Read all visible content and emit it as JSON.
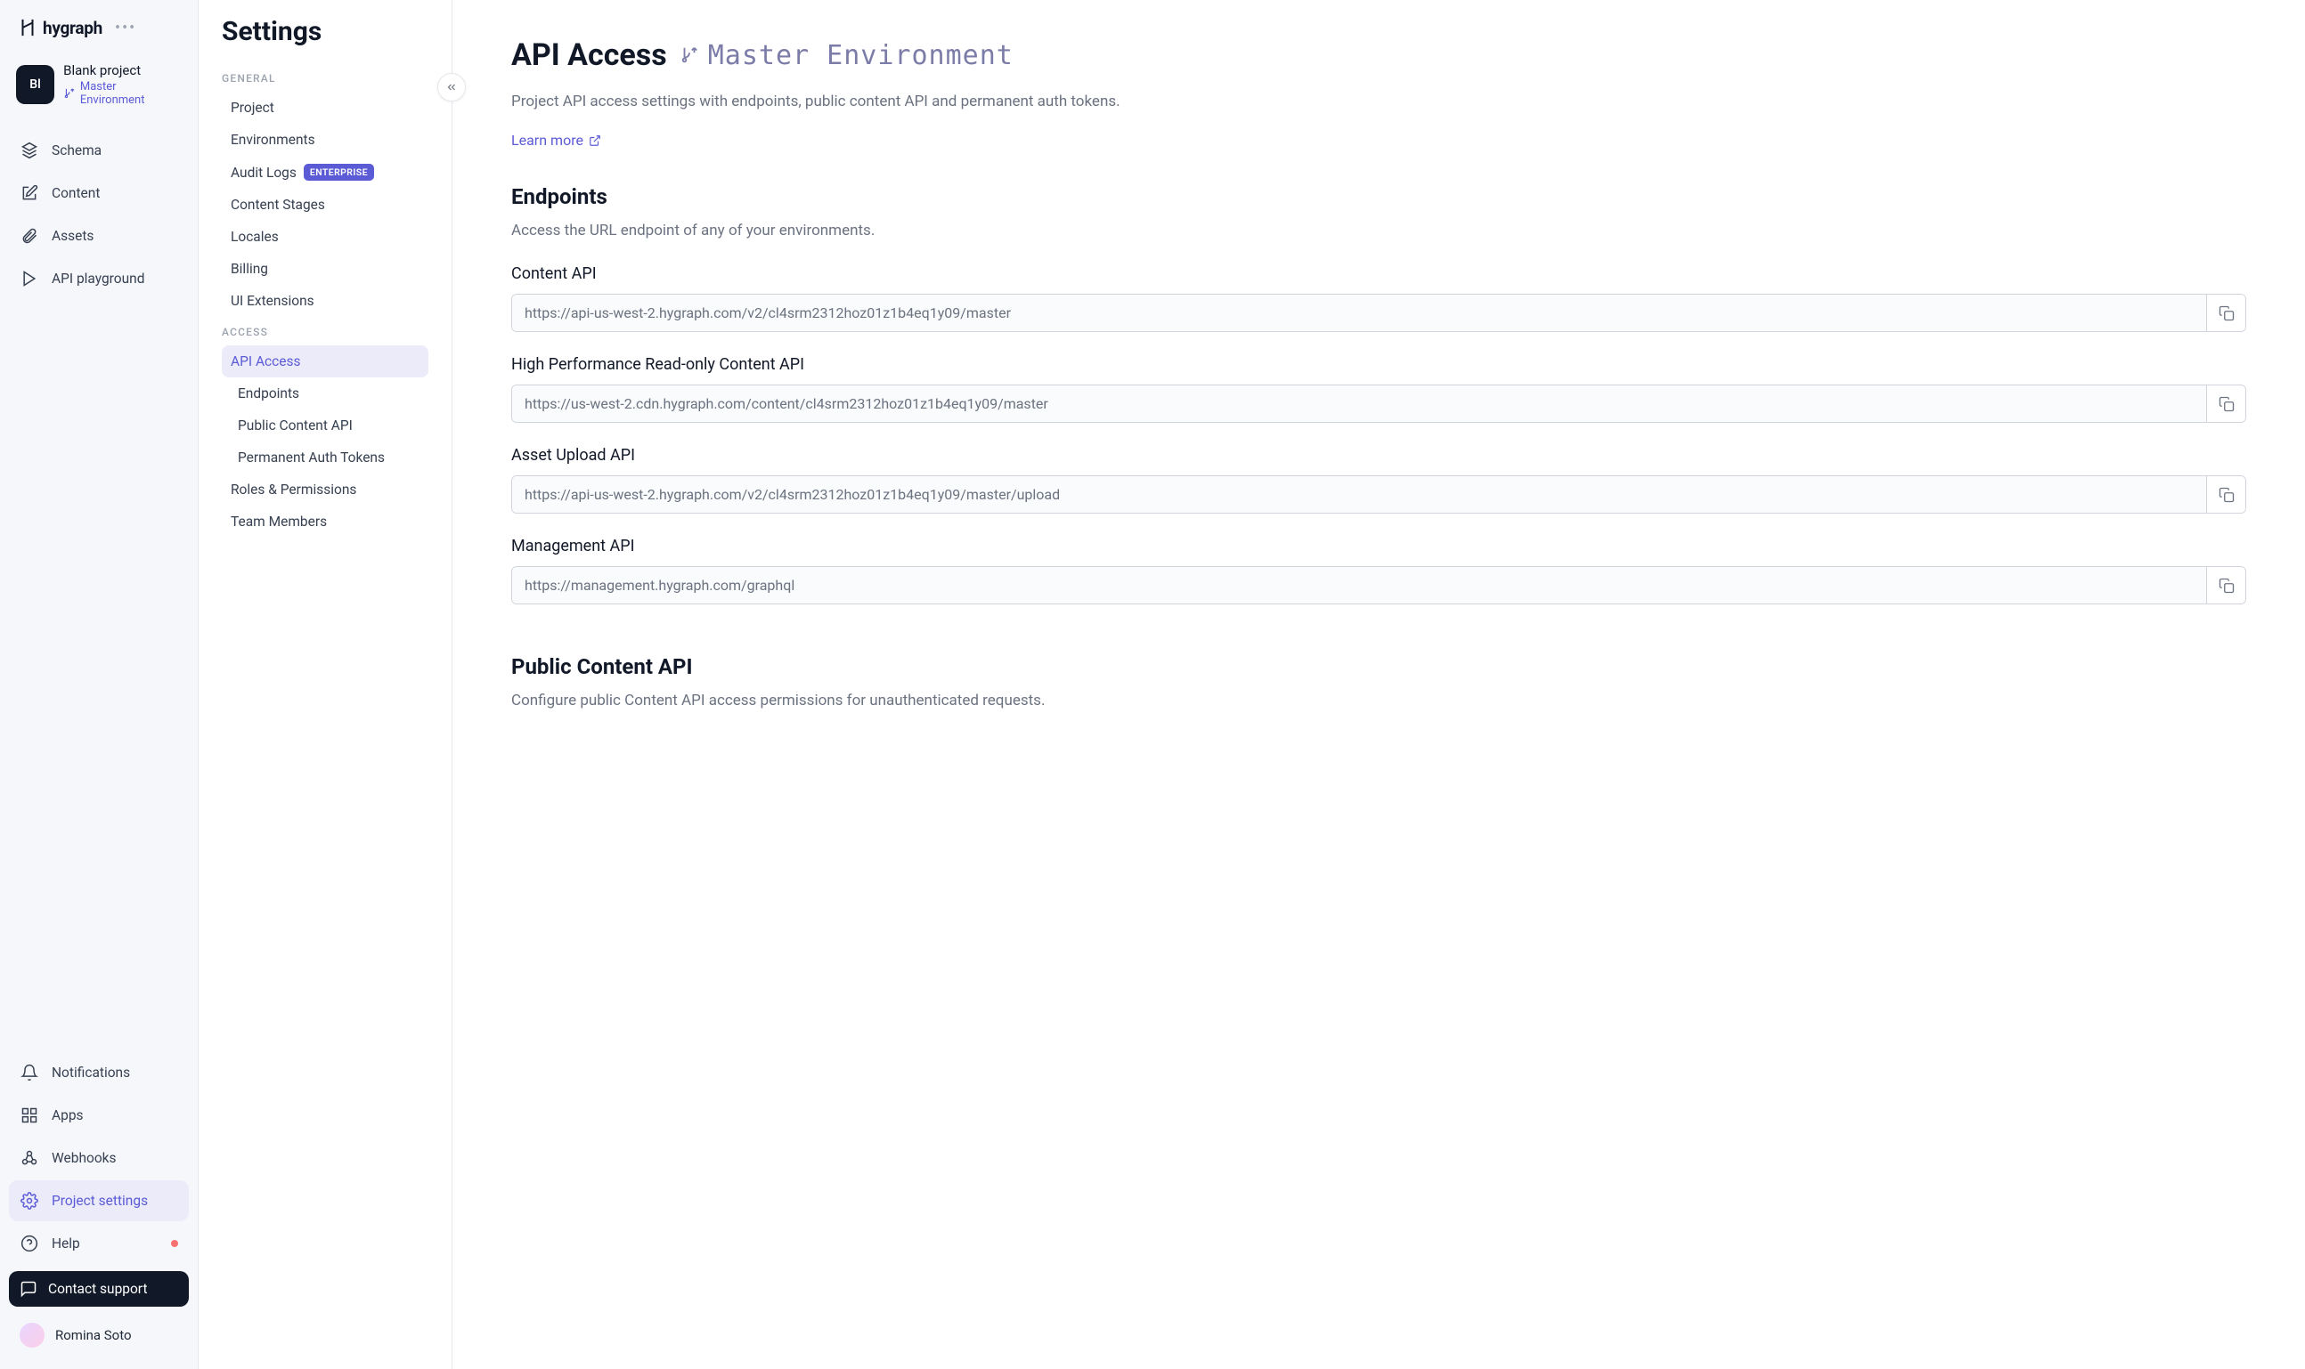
{
  "logo_text": "hygraph",
  "project": {
    "avatar_text": "Bl",
    "name": "Blank project",
    "environment": "Master Environment"
  },
  "nav": {
    "schema": "Schema",
    "content": "Content",
    "assets": "Assets",
    "api_playground": "API playground",
    "notifications": "Notifications",
    "apps": "Apps",
    "webhooks": "Webhooks",
    "project_settings": "Project settings",
    "help": "Help",
    "contact_support": "Contact support"
  },
  "user": {
    "name": "Romina Soto"
  },
  "settings": {
    "title": "Settings",
    "sections": {
      "general_label": "GENERAL",
      "access_label": "ACCESS",
      "project": "Project",
      "environments": "Environments",
      "audit_logs": "Audit Logs",
      "enterprise_badge": "ENTERPRISE",
      "content_stages": "Content Stages",
      "locales": "Locales",
      "billing": "Billing",
      "ui_extensions": "UI Extensions",
      "api_access": "API Access",
      "endpoints_sub": "Endpoints",
      "public_content_api_sub": "Public Content API",
      "permanent_auth_tokens_sub": "Permanent Auth Tokens",
      "roles_permissions": "Roles & Permissions",
      "team_members": "Team Members"
    }
  },
  "page": {
    "title": "API Access",
    "environment": "Master Environment",
    "description": "Project API access settings with endpoints, public content API and permanent auth tokens.",
    "learn_more": "Learn more",
    "endpoints_title": "Endpoints",
    "endpoints_desc": "Access the URL endpoint of any of your environments.",
    "endpoints": [
      {
        "label": "Content API",
        "url": "https://api-us-west-2.hygraph.com/v2/cl4srm2312hoz01z1b4eq1y09/master"
      },
      {
        "label": "High Performance Read-only Content API",
        "url": "https://us-west-2.cdn.hygraph.com/content/cl4srm2312hoz01z1b4eq1y09/master"
      },
      {
        "label": "Asset Upload API",
        "url": "https://api-us-west-2.hygraph.com/v2/cl4srm2312hoz01z1b4eq1y09/master/upload"
      },
      {
        "label": "Management API",
        "url": "https://management.hygraph.com/graphql"
      }
    ],
    "public_content_title": "Public Content API",
    "public_content_desc": "Configure public Content API access permissions for unauthenticated requests."
  }
}
